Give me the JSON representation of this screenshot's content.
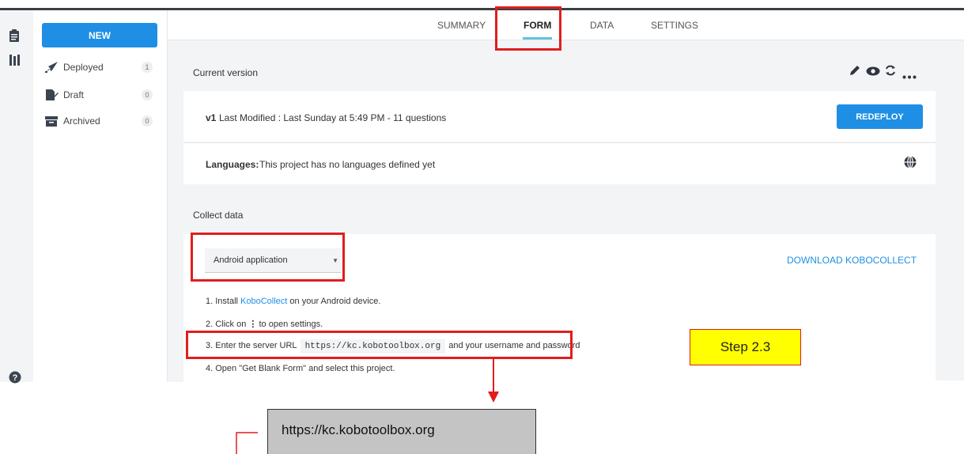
{
  "nav": {
    "new_label": "NEW",
    "items": [
      {
        "label": "Deployed",
        "count": "1"
      },
      {
        "label": "Draft",
        "count": "0"
      },
      {
        "label": "Archived",
        "count": "0"
      }
    ]
  },
  "tabs": [
    "SUMMARY",
    "FORM",
    "DATA",
    "SETTINGS"
  ],
  "current_version": {
    "heading": "Current version",
    "version": "v1",
    "modified_text": "Last Modified : Last Sunday at 5:49 PM - 11 questions",
    "redeploy_label": "REDEPLOY",
    "languages_label": "Languages:",
    "languages_text": "This project has no languages defined yet"
  },
  "collect": {
    "heading": "Collect data",
    "method": "Android application",
    "download_label": "DOWNLOAD KOBOCOLLECT",
    "step1_pre": "1. Install",
    "step1_link": "KoboCollect",
    "step1_post": "on your Android device.",
    "step2_pre": "2. Click on",
    "step2_post": "to open settings.",
    "step3_pre": "3. Enter the server URL",
    "server_url": "https://kc.kobotoolbox.org",
    "step3_post": "and your username and password",
    "step4": "4. Open \"Get Blank Form\" and select this project."
  },
  "annotations": {
    "step_label": "Step 2.3",
    "url_callout": "https://kc.kobotoolbox.org"
  },
  "colors": {
    "accent": "#1e8fe4",
    "highlight": "#e11d1d",
    "callout": "#ffff00"
  },
  "icons": [
    "clipboard-icon",
    "library-icon",
    "help-icon",
    "rocket-icon",
    "draft-icon",
    "archive-icon",
    "pencil-icon",
    "eye-icon",
    "replace-icon",
    "more-icon",
    "globe-icon",
    "kebab-icon",
    "dropdown-arrow-icon"
  ]
}
